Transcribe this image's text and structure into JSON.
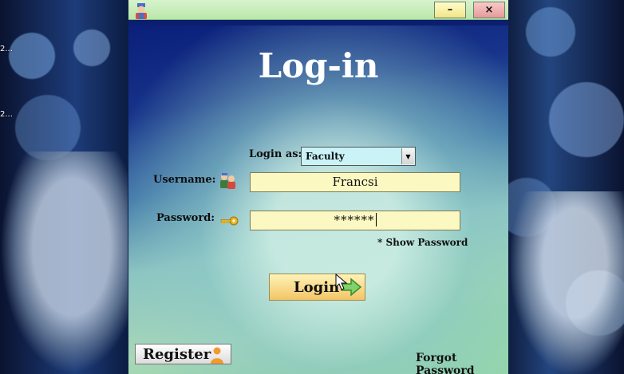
{
  "desktop": {
    "label_1": "2...",
    "label_2": "2..."
  },
  "window": {
    "minimize_label": "–",
    "close_label": "×",
    "title": "Log-in",
    "login_as": {
      "label": "Login as:",
      "selected": "Faculty"
    },
    "username": {
      "label": "Username:",
      "value": "Francsi"
    },
    "password": {
      "label": "Password:",
      "value": "******"
    },
    "show_password": "* Show Password",
    "login_button": "Login",
    "register_button": "Register",
    "forgot_password": "Forgot Password"
  },
  "colors": {
    "title_text": "#ffffff",
    "field_background": "#fbf8c2",
    "select_background": "#c9f3f7",
    "titlebar": "#c8edbb"
  }
}
